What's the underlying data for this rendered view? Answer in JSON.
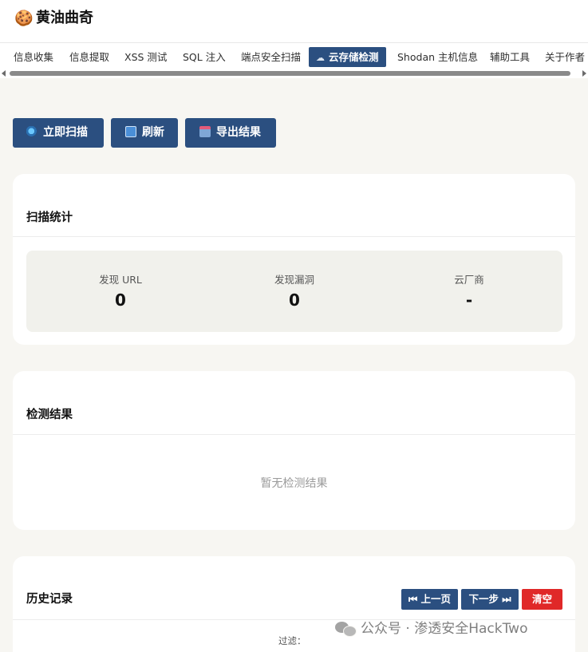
{
  "header": {
    "logo_icon": "🍪",
    "title": "黄油曲奇"
  },
  "tabs": [
    {
      "label": "信息收集",
      "active": false
    },
    {
      "label": "信息提取",
      "active": false
    },
    {
      "label": "XSS 测试",
      "active": false
    },
    {
      "label": "SQL 注入",
      "active": false
    },
    {
      "label": "端点安全扫描",
      "active": false
    },
    {
      "label": "云存储检测",
      "active": true,
      "icon": "cloud-icon"
    },
    {
      "label": "Shodan 主机信息",
      "active": false
    },
    {
      "label": "辅助工具",
      "active": false
    },
    {
      "label": "关于作者",
      "active": false
    }
  ],
  "toolbar": {
    "scan_label": "立即扫描",
    "refresh_label": "刷新",
    "export_label": "导出结果"
  },
  "stats": {
    "title": "扫描统计",
    "items": [
      {
        "label": "发现 URL",
        "value": "0"
      },
      {
        "label": "发现漏洞",
        "value": "0"
      },
      {
        "label": "云厂商",
        "value": "-"
      }
    ]
  },
  "results": {
    "title": "检测结果",
    "empty_text": "暂无检测结果"
  },
  "history": {
    "title": "历史记录",
    "prev_label": "⏮ 上一页",
    "next_label": "下一步 ⏭",
    "clear_label": "清空",
    "filter_label": "过滤："
  },
  "watermark": {
    "text": "公众号 · 渗透安全HackTwo"
  },
  "colors": {
    "primary": "#2b4f80",
    "danger": "#e02828",
    "background": "#f7f6f2"
  }
}
